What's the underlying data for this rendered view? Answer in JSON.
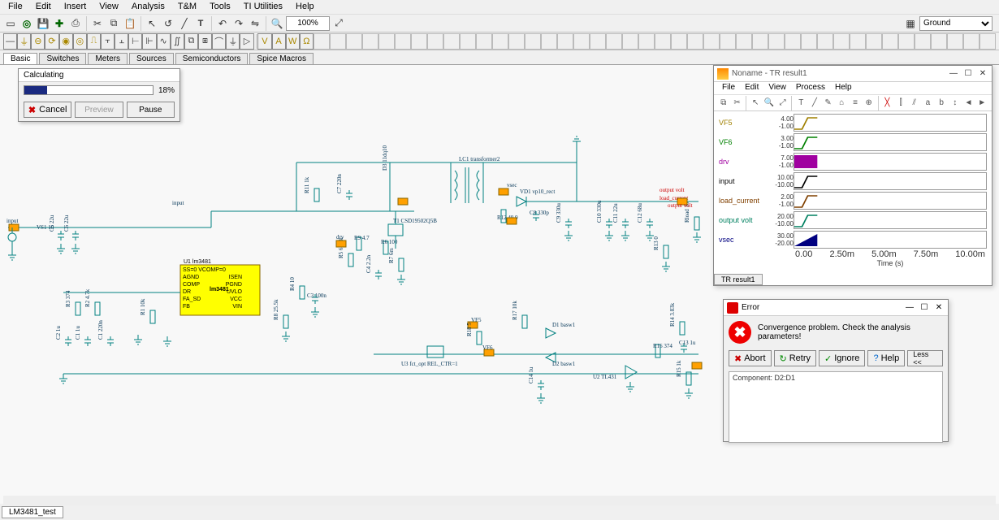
{
  "menu": {
    "items": [
      "File",
      "Edit",
      "Insert",
      "View",
      "Analysis",
      "T&M",
      "Tools",
      "TI Utilities",
      "Help"
    ]
  },
  "toolbar": {
    "zoom": "100%",
    "ground": "Ground"
  },
  "palette_tabs": [
    "Basic",
    "Switches",
    "Meters",
    "Sources",
    "Semiconductors",
    "Spice Macros"
  ],
  "progress": {
    "title": "Calculating",
    "percent": 18,
    "pct_text": "18%",
    "cancel": "Cancel",
    "preview": "Preview",
    "pause": "Pause"
  },
  "trwin": {
    "title": "Noname - TR result1",
    "menu": [
      "File",
      "Edit",
      "View",
      "Process",
      "Help"
    ],
    "rows": [
      {
        "label": "VF5",
        "hi": "4.00",
        "lo": "-1.00",
        "color": "#a08000"
      },
      {
        "label": "VF6",
        "hi": "3.00",
        "lo": "-1.00",
        "color": "#008000"
      },
      {
        "label": "drv",
        "hi": "7.00",
        "lo": "-1.00",
        "color": "#a000a0"
      },
      {
        "label": "input",
        "hi": "10.00",
        "lo": "-10.00",
        "color": "#000000"
      },
      {
        "label": "load_current",
        "hi": "2.00",
        "lo": "-1.00",
        "color": "#804000"
      },
      {
        "label": "output volt",
        "hi": "20.00",
        "lo": "-10.00",
        "color": "#008060"
      },
      {
        "label": "vsec",
        "hi": "30.00",
        "lo": "-20.00",
        "color": "#000080"
      }
    ],
    "xticks": [
      "0.00",
      "2.50m",
      "5.00m",
      "7.50m",
      "10.00m"
    ],
    "xlabel": "Time (s)",
    "tab": "TR result1"
  },
  "error": {
    "title": "Error",
    "message": "Convergence problem. Check the analysis parameters!",
    "detail": "Component: D2:D1",
    "btns": {
      "abort": "Abort",
      "retry": "Retry",
      "ignore": "Ignore",
      "help": "Help",
      "less": "Less <<"
    }
  },
  "bottom_tab": "LM3481_test",
  "schematic": {
    "input_label": "input",
    "chip": {
      "ref": "U1 lm3481",
      "name": "lm3481",
      "pins_l": [
        "SS=0 VCOMP=0",
        "AGND",
        "COMP",
        "DR",
        "FA_SD",
        "FB"
      ],
      "pins_r": [
        "",
        "ISEN",
        "PGND",
        "UVLO",
        "VCC",
        "VIN"
      ]
    },
    "vs1": "VS1 10",
    "c5": "C5 22u",
    "c6": "C6 22u",
    "c8": "C8 330p",
    "c9": "C9 330u",
    "c10": "C10 330u",
    "c11": "C11 22u",
    "c12": "C12 68u",
    "c13": "C13 1u",
    "c14": "C14 1u",
    "c1": "C1 1u",
    "c2": "C2 1u",
    "c3": "C3 100n",
    "c4": "C4 2.2n",
    "c7": "C7 220n",
    "c1b": "C1 220n",
    "r2": "R2 4.7k",
    "r3": "R3 374",
    "r5": "R5 60.4k",
    "r7": "R7 6m",
    "r8": "R8 25.5k",
    "r9": "R9 4.7",
    "r11": "R11 1k",
    "r12": "R12 49.9",
    "r13": "R13 0",
    "r14": "R14 3.83k",
    "r15": "R15 1k",
    "r16": "R16 374",
    "r17": "R17 10k",
    "r18": "R18 5",
    "r4": "R4 10",
    "r1": "R1 10k",
    "r6": "R6 100",
    "rload": "Rload 10",
    "vd1": "VD1 vp10_rect",
    "d1": "D1 basw1",
    "d2": "D2 basw1",
    "t1": "T1 CSD19502Q5B",
    "lc1": "LC1 transformer2",
    "u2": "U2 TL431",
    "u3": "U3 fct_opt\nREL_CTR=1",
    "vsec": "vsec",
    "drv": "drv",
    "vf5": "VF5",
    "vf6": "VF6",
    "inputpin": "input",
    "out_v": "output volt",
    "out_v2": "output volt",
    "load_c": "load_current"
  },
  "chart_data": [
    {
      "type": "line",
      "title": "VF5",
      "ylim": [
        -1,
        4
      ],
      "x": [
        0,
        0.0005,
        0.001
      ],
      "y": [
        0,
        3.5,
        3.5
      ],
      "color": "#a08000"
    },
    {
      "type": "line",
      "title": "VF6",
      "ylim": [
        -1,
        3
      ],
      "x": [
        0,
        0.0005,
        0.001
      ],
      "y": [
        0,
        2.4,
        2.4
      ],
      "color": "#008000"
    },
    {
      "type": "area",
      "title": "drv",
      "ylim": [
        -1,
        7
      ],
      "x": [
        0,
        0.001
      ],
      "y": [
        5,
        5
      ],
      "color": "#a000a0"
    },
    {
      "type": "line",
      "title": "input",
      "ylim": [
        -10,
        10
      ],
      "x": [
        0,
        0.0005,
        0.001
      ],
      "y": [
        0,
        9,
        9
      ],
      "color": "#000000"
    },
    {
      "type": "line",
      "title": "load_current",
      "ylim": [
        -1,
        2
      ],
      "x": [
        0,
        0.001
      ],
      "y": [
        0,
        1.3
      ],
      "color": "#804000"
    },
    {
      "type": "line",
      "title": "output volt",
      "ylim": [
        -10,
        20
      ],
      "x": [
        0,
        0.001
      ],
      "y": [
        0,
        13
      ],
      "color": "#008060"
    },
    {
      "type": "area",
      "title": "vsec",
      "ylim": [
        -20,
        30
      ],
      "x": [
        0,
        0.001
      ],
      "y": [
        0,
        24
      ],
      "color": "#000080"
    }
  ]
}
